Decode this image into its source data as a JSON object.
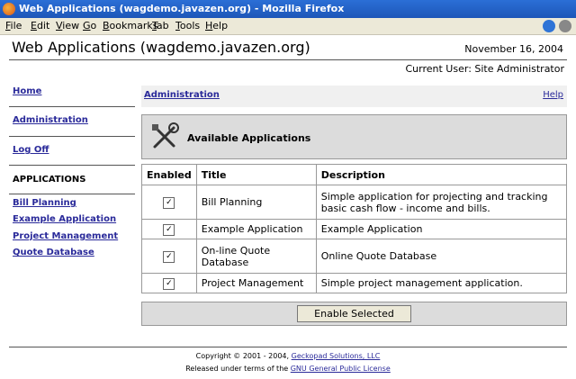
{
  "window": {
    "title": "Web Applications (wagdemo.javazen.org) - Mozilla Firefox",
    "icon": "firefox-icon"
  },
  "menu": [
    {
      "label": "File",
      "u": "F"
    },
    {
      "label": "Edit",
      "u": "E"
    },
    {
      "label": "View",
      "u": "V"
    },
    {
      "label": "Go",
      "u": "G"
    },
    {
      "label": "Bookmarks",
      "u": "B"
    },
    {
      "label": "Tab",
      "u": "T"
    },
    {
      "label": "Tools",
      "u": "T"
    },
    {
      "label": "Help",
      "u": "H"
    }
  ],
  "header": {
    "site_title": "Web Applications (wagdemo.javazen.org)",
    "date": "November 16, 2004",
    "current_user": "Current User: Site Administrator"
  },
  "nav": {
    "home": "Home",
    "administration": "Administration",
    "logoff": "Log Off",
    "apps_heading": "APPLICATIONS",
    "apps": [
      "Bill Planning",
      "Example Application",
      "Project Management",
      "Quote Database"
    ]
  },
  "main": {
    "breadcrumb": "Administration",
    "help": "Help",
    "section_title": "Available Applications",
    "columns": [
      "Enabled",
      "Title",
      "Description"
    ],
    "rows": [
      {
        "enabled": true,
        "title": "Bill Planning",
        "description": "Simple application for projecting and tracking basic cash flow - income and bills."
      },
      {
        "enabled": true,
        "title": "Example Application",
        "description": "Example Application"
      },
      {
        "enabled": true,
        "title": "On-line Quote Database",
        "description": "Online Quote Database"
      },
      {
        "enabled": true,
        "title": "Project Management",
        "description": "Simple project management application."
      }
    ],
    "enable_button": "Enable Selected"
  },
  "footer": {
    "copy_prefix": "Copyright © 2001 - 2004,",
    "company": "Geckopad Solutions, LLC",
    "license_prefix": "Released under terms of the",
    "license": "GNU General Public License"
  }
}
